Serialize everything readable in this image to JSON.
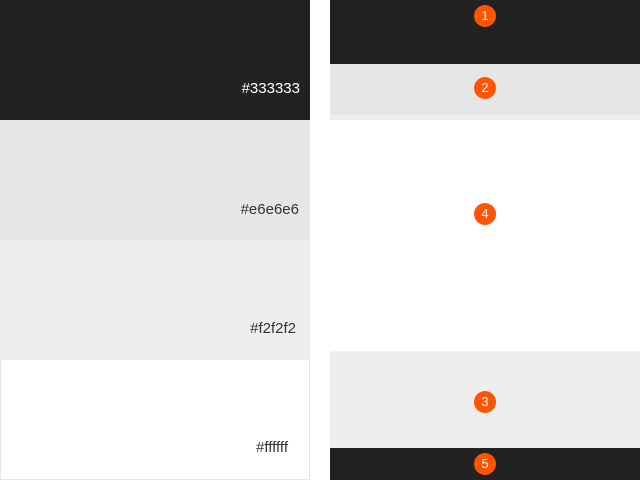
{
  "swatches": [
    {
      "label": "#333333",
      "color": "#222222",
      "text_color": "#ffffff"
    },
    {
      "label": "#e6e6e6",
      "color": "#e6e6e6",
      "text_color": "#333333"
    },
    {
      "label": "#f2f2f2",
      "color": "#eeeeee",
      "text_color": "#333333"
    },
    {
      "label": "#ffffff",
      "color": "#ffffff",
      "text_color": "#333333"
    }
  ],
  "regions": {
    "header": {
      "number": "1",
      "color": "#222222"
    },
    "subheader": {
      "number": "2",
      "color": "#e6e6e6",
      "strip_color": "#eeeeee"
    },
    "content": {
      "number": "4",
      "color": "#ffffff"
    },
    "lower": {
      "number": "3",
      "color": "#eeeeee"
    },
    "footer": {
      "number": "5",
      "color": "#222222"
    }
  },
  "badge_color": "#ff5500"
}
